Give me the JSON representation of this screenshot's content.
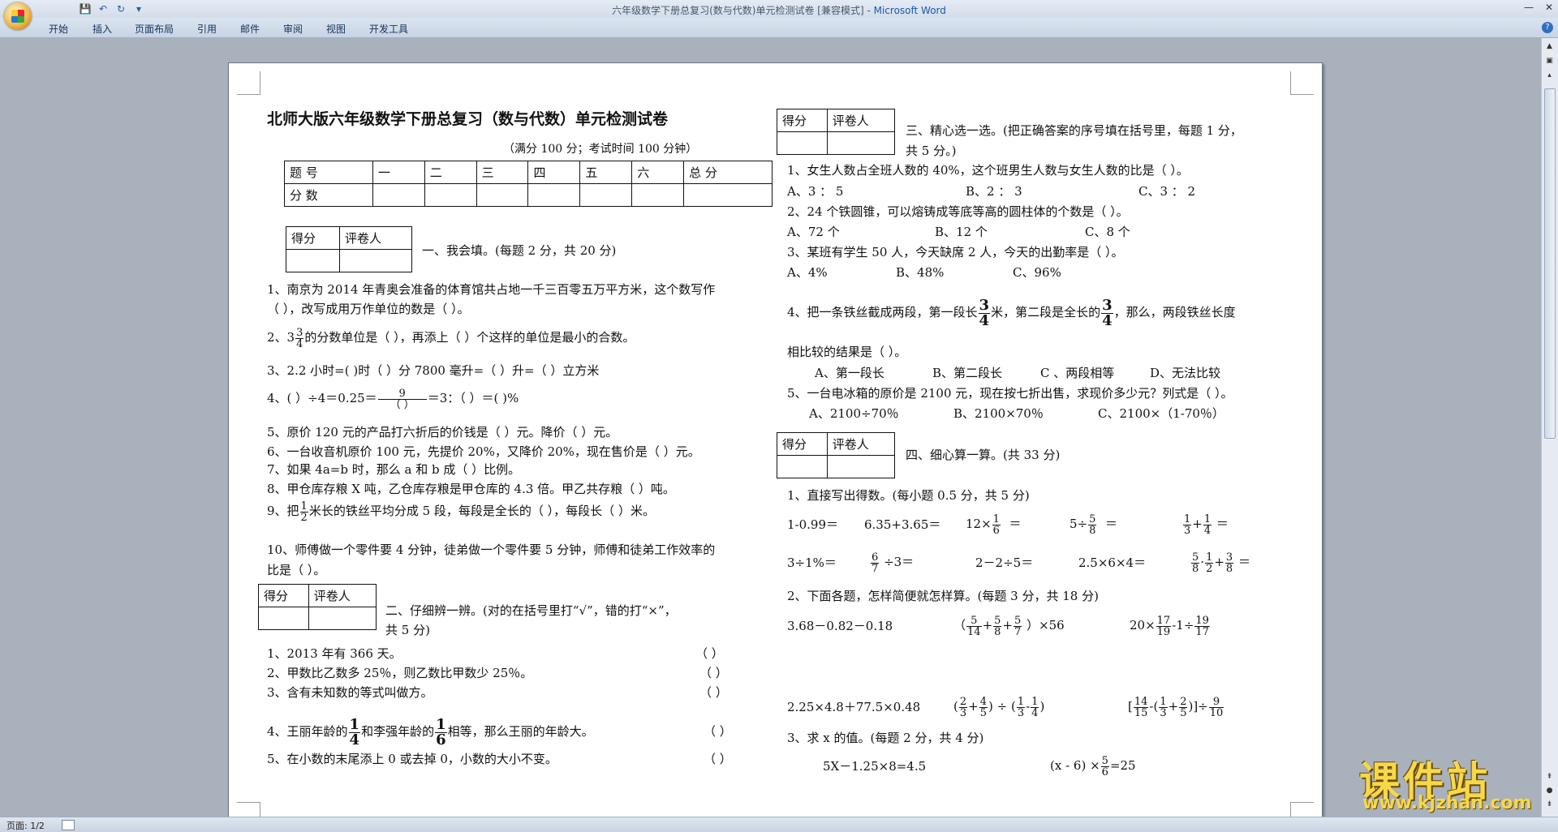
{
  "window": {
    "title": "六年级数学下册总复习(数与代数)单元检测试卷 [兼容模式]",
    "app": "Microsoft Word",
    "title_sep": " - "
  },
  "ribbon": {
    "tabs": [
      "开始",
      "插入",
      "页面布局",
      "引用",
      "邮件",
      "审阅",
      "视图",
      "开发工具"
    ]
  },
  "status": {
    "page": "页面: 1/2"
  },
  "doc": {
    "title": "北师大版六年级数学下册总复习（数与代数）单元检测试卷",
    "subtitle": "（满分 100 分；考试时间 100 分钟）",
    "score_table": {
      "row1": [
        "题 号",
        "一",
        "二",
        "三",
        "四",
        "五",
        "六",
        "总 分"
      ],
      "row2_label": "分 数"
    },
    "scorer": {
      "c1": "得分",
      "c2": "评卷人"
    },
    "sec1": {
      "heading": "一、我会填。(每题 2 分，共 20 分)",
      "q1a": "1、南京为 2014 年青奥会准备的体育馆共占地一千三百零五万平方米，这个数写作",
      "q1b": "（                ），改写成用万作单位的数是（              ）。",
      "q2_pre": "2、3",
      "q2_fn": "3",
      "q2_fd": "4",
      "q2_post": "的分数单位是（      ），再添上（      ）个这样的单位是最小的合数。",
      "q3": "3、2.2 小时=(      )时（      ）分      7800 毫升=（      ）升=（      ）立方米",
      "q4_pre": "4、(      ）÷4＝0.25＝",
      "q4_fn": "9",
      "q4_fd": "（    ）",
      "q4_post": "＝3：（      ）＝(         )%",
      "q5": "5、原价 120 元的产品打六折后的价钱是（          ）元。降价（          ）元。",
      "q6": "6、一台收音机原价 100 元，先提价 20%，又降价 20%，现在售价是（          ）元。",
      "q7": "7、如果 4a=b 时，那么 a 和 b 成（      ）比例。",
      "q8": "8、甲仓库存粮 X 吨，乙仓库存粮是甲仓库的 4.3 倍。甲乙共存粮（      ）吨。",
      "q9_pre": "9、把",
      "q9_fn": "1",
      "q9_fd": "2",
      "q9_post": "米长的铁丝平均分成 5 段，每段是全长的（      ），每段长（        ）米。",
      "q10a": "10、师傅做一个零件要 4 分钟，徒弟做一个零件要 5 分钟，师傅和徒弟工作效率的",
      "q10b": "比是（            ）。"
    },
    "sec2": {
      "heading_a": "二、仔细辨一辨。(对的在括号里打“√”，错的打“×”，",
      "heading_b": "共 5 分)",
      "q1": "1、2013 年有 366 天。",
      "q2": "2、甲数比乙数多 25％，则乙数比甲数少 25％。",
      "q3": "3、含有未知数的等式叫做方。",
      "q4_pre": "4、王丽年龄的",
      "q4_fn1": "1",
      "q4_fd1": "4",
      "q4_mid": "和李强年龄的",
      "q4_fn2": "1",
      "q4_fd2": "6",
      "q4_post": "相等，那么王丽的年龄大。",
      "q5": "5、在小数的末尾添上 0 或去掉 0，小数的大小不变。",
      "paren": "（      ）"
    },
    "sec3": {
      "heading_a": "三、精心选一选。(把正确答案的序号填在括号里，每题 1 分，",
      "heading_b": "共 5 分。)",
      "q1": "1、女生人数占全班人数的 40%，这个班男生人数与女生人数的比是（      ）。",
      "q1_opts": [
        "A、3 ：  5",
        "B、2 ：  3",
        "C、3 ：  2"
      ],
      "q2": "2、24 个铁圆锥，可以熔铸成等底等高的圆柱体的个数是（      ）。",
      "q2_opts": [
        "A、72 个",
        "B、12 个",
        "C、8 个"
      ],
      "q3": "3、某班有学生 50 人，今天缺席 2 人，今天的出勤率是（      ）。",
      "q3_opts": [
        "A、4%",
        "B、48%",
        "C、96%"
      ],
      "q4_pre": "4、把一条铁丝截成两段，第一段长",
      "q4_fn1": "3",
      "q4_fd1": "4",
      "q4_mid": "米，第二段是全长的",
      "q4_fn2": "3",
      "q4_fd2": "4",
      "q4_post": "，那么，两段铁丝长度",
      "q4b": "相比较的结果是（      ）。",
      "q4_opts": [
        "A、第一段长",
        "B、第二段长",
        "C  、两段相等",
        "D、无法比较"
      ],
      "q5": "5、一台电冰箱的原价是 2100 元，现在按七折出售，求现价多少元？列式是（      ）。",
      "q5_opts": [
        "A、2100÷70％",
        "B、2100×70％",
        "C、2100×（1-70％）"
      ]
    },
    "sec4": {
      "heading": "四、细心算一算。(共 33 分)",
      "p1": "1、直接写出得数。(每小题 0.5 分，共 5 分)",
      "r1": [
        "1-0.99＝",
        "6.35+3.65＝",
        "12×",
        "＝",
        "5÷",
        "＝",
        "＝"
      ],
      "r1_f1": [
        "1",
        "6"
      ],
      "r1_f2": [
        "5",
        "8"
      ],
      "r1_f3": [
        "1",
        "3"
      ],
      "r1_f4": [
        "1",
        "4"
      ],
      "r2": [
        "3÷1%＝",
        "÷3＝",
        "2－2÷5＝",
        "2.5×6×4＝",
        "＝"
      ],
      "r2_f1": [
        "6",
        "7"
      ],
      "r2_f2": [
        "5",
        "8"
      ],
      "r2_f3": [
        "1",
        "2"
      ],
      "r2_f4": [
        "3",
        "8"
      ],
      "p2": "2、下面各题，怎样简便就怎样算。(每题 3 分，共 18 分)",
      "c1": "3.68－0.82－0.18",
      "c2_f": [
        [
          "5",
          "14"
        ],
        [
          "5",
          "8"
        ],
        [
          "5",
          "7"
        ]
      ],
      "c2_post": "）×56",
      "c3_pre": "20×",
      "c3_f1": [
        "17",
        "19"
      ],
      "c3_mid": "-1÷",
      "c3_f2": [
        "19",
        "17"
      ],
      "c4": "2.25×4.8＋77.5×0.48",
      "c5_f": [
        [
          "2",
          "3"
        ],
        [
          "4",
          "5"
        ],
        [
          "1",
          "3"
        ],
        [
          "1",
          "4"
        ]
      ],
      "c6_f": [
        [
          "14",
          "15"
        ],
        [
          "1",
          "3"
        ],
        [
          "2",
          "5"
        ],
        [
          "9",
          "10"
        ]
      ],
      "p3": "3、求 x 的值。(每题 2 分，共 4 分)",
      "e1": "5X－1.25×8=4.5",
      "e2_pre": "(x - 6)  ×",
      "e2_f": [
        "5",
        "6"
      ],
      "e2_post": "=25"
    }
  },
  "watermark": {
    "text": "课件站",
    "url": "www.kjzhan.com"
  }
}
